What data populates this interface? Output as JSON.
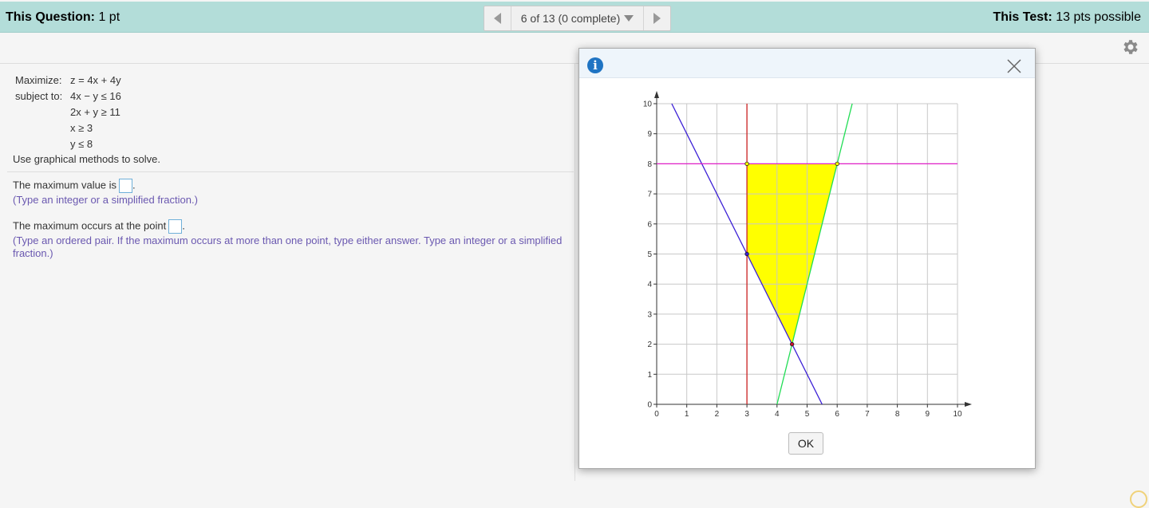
{
  "header": {
    "question_label": "This Question:",
    "question_value": "1 pt",
    "nav_text": "6 of 13 (0 complete)",
    "test_label": "This Test:",
    "test_value": "13 pts possible"
  },
  "problem": {
    "maximize_label": "Maximize:",
    "objective": "z = 4x + 4y",
    "subject_label": "subject to:",
    "constraints": [
      "4x − y ≤ 16",
      "2x + y ≥ 11",
      "x ≥ 3",
      "y ≤ 8"
    ],
    "instruction": "Use graphical methods to solve."
  },
  "questions": {
    "q1_text": "The maximum value is",
    "q1_hint": "(Type an integer or a simplified fraction.)",
    "q2_text": "The maximum occurs at the point",
    "q2_hint": "(Type an ordered pair. If the maximum occurs at more than one point, type either answer. Type an integer or a simplified fraction.)"
  },
  "modal": {
    "info_glyph": "i",
    "ok_label": "OK"
  },
  "colors": {
    "header_bg": "#b3ddd9",
    "feasible_fill": "#ffff00",
    "line_4x_minus_y": "#22dd55",
    "line_2x_plus_y": "#3b1fd6",
    "line_x_eq_3": "#cc2222",
    "line_y_eq_8": "#e020c8",
    "hint_text": "#6a58b0"
  },
  "chart_data": {
    "type": "line",
    "xlim": [
      0,
      10
    ],
    "ylim": [
      0,
      10
    ],
    "grid": true,
    "x_ticks": [
      "0",
      "1",
      "2",
      "3",
      "4",
      "5",
      "6",
      "7",
      "8",
      "9",
      "10"
    ],
    "y_ticks": [
      "0",
      "1",
      "2",
      "3",
      "4",
      "5",
      "6",
      "7",
      "8",
      "9",
      "10"
    ],
    "lines": [
      {
        "label": "4x − y = 16",
        "x": [
          4,
          6.5
        ],
        "y": [
          0,
          10
        ],
        "color": "#22dd55"
      },
      {
        "label": "2x + y = 11",
        "x": [
          0.5,
          5.5
        ],
        "y": [
          10,
          0
        ],
        "color": "#3b1fd6"
      },
      {
        "label": "x = 3",
        "x": [
          3,
          3
        ],
        "y": [
          0,
          10
        ],
        "color": "#cc2222"
      },
      {
        "label": "y = 8",
        "x": [
          0,
          10
        ],
        "y": [
          8,
          8
        ],
        "color": "#e020c8"
      }
    ],
    "feasible_region": [
      [
        3,
        8
      ],
      [
        6,
        8
      ],
      [
        4.5,
        2
      ],
      [
        3,
        5
      ]
    ],
    "vertices": [
      {
        "x": 3,
        "y": 8,
        "fill": "#ffff00"
      },
      {
        "x": 6,
        "y": 8,
        "fill": "#ffff00"
      },
      {
        "x": 3,
        "y": 5,
        "fill": "#3b1fd6"
      },
      {
        "x": 4.5,
        "y": 2,
        "fill": "#c8102e"
      }
    ]
  }
}
